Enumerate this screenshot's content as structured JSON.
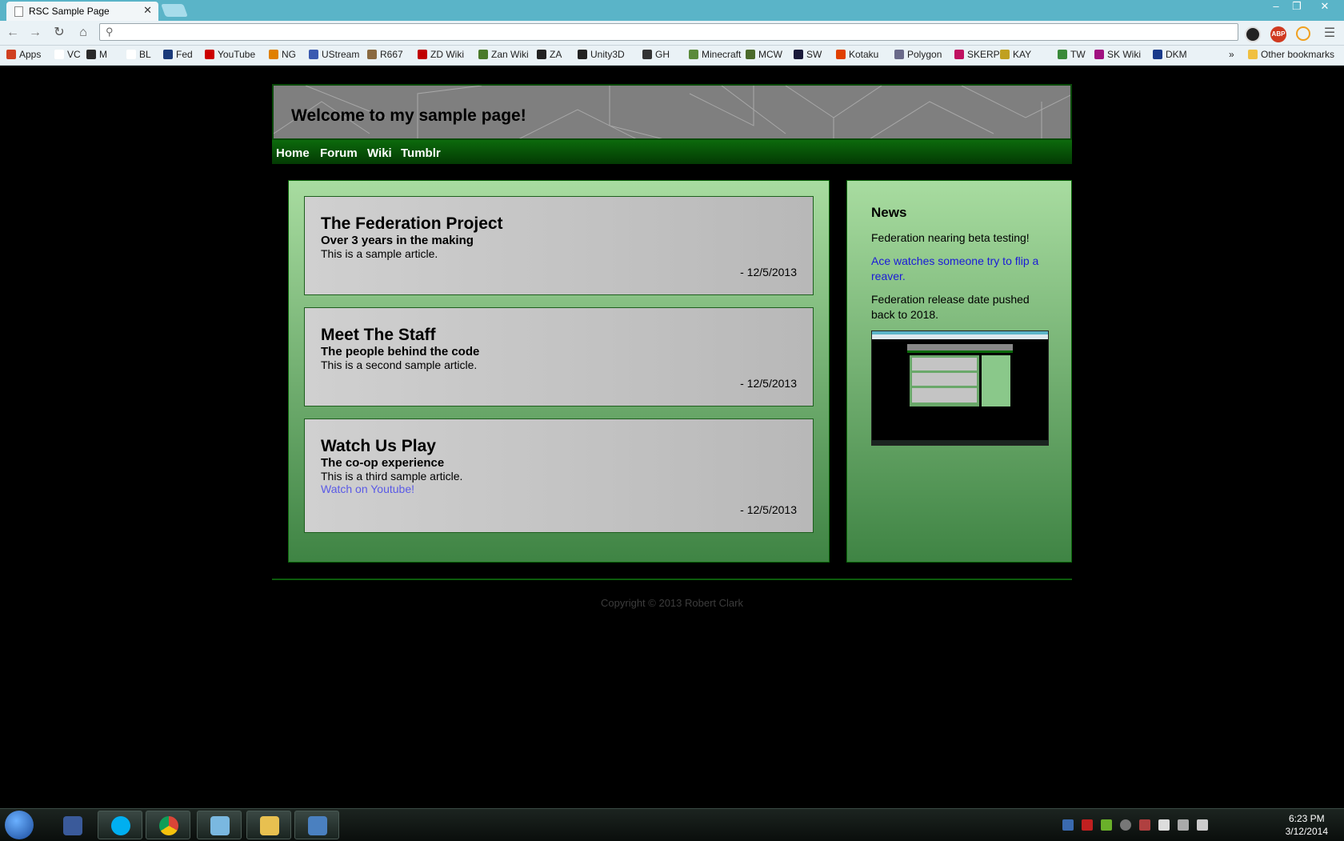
{
  "browser": {
    "tab_title": "RSC Sample Page",
    "tab_close": "✕",
    "url": "",
    "bookmarks": [
      {
        "label": "Apps",
        "color": "#d04020"
      },
      {
        "label": "VC",
        "color": "#ffffff"
      },
      {
        "label": "M",
        "color": "#2a2a2a"
      },
      {
        "label": "BL",
        "color": "#ffffff"
      },
      {
        "label": "Fed",
        "color": "#1a3a7a"
      },
      {
        "label": "YouTube",
        "color": "#cc0000"
      },
      {
        "label": "NG",
        "color": "#e08000"
      },
      {
        "label": "UStream",
        "color": "#3a5ab0"
      },
      {
        "label": "R667",
        "color": "#8a6a40"
      },
      {
        "label": "ZD Wiki",
        "color": "#c00000"
      },
      {
        "label": "Zan Wiki",
        "color": "#4a7a2a"
      },
      {
        "label": "ZA",
        "color": "#222222"
      },
      {
        "label": "Unity3D",
        "color": "#222222"
      },
      {
        "label": "GH",
        "color": "#333333"
      },
      {
        "label": "Minecraft",
        "color": "#5a8a3a"
      },
      {
        "label": "MCW",
        "color": "#4a6a2a"
      },
      {
        "label": "SW",
        "color": "#1a1a3a"
      },
      {
        "label": "Kotaku",
        "color": "#e04000"
      },
      {
        "label": "Polygon",
        "color": "#6a6a8a"
      },
      {
        "label": "SKERP",
        "color": "#c01060"
      },
      {
        "label": "KAY",
        "color": "#c0a020"
      },
      {
        "label": "TW",
        "color": "#3a8a3a"
      },
      {
        "label": "SK Wiki",
        "color": "#a01080"
      },
      {
        "label": "DKM",
        "color": "#1a3a8a"
      }
    ],
    "more_bookmarks": "»",
    "other_bookmarks": "Other bookmarks",
    "extensions": [
      {
        "label": "",
        "color": "#2a2a2a"
      },
      {
        "label": "ABP",
        "color": "#d03a20"
      },
      {
        "label": "",
        "color": "#f0a020"
      }
    ]
  },
  "site": {
    "title": "Welcome to my sample page!",
    "nav": [
      "Home",
      "Forum",
      "Wiki",
      "Tumblr"
    ],
    "articles": [
      {
        "title": "The Federation Project",
        "subtitle": "Over 3 years in the making",
        "body": "This is a sample article.",
        "link": "",
        "date": "- 12/5/2013"
      },
      {
        "title": "Meet The Staff",
        "subtitle": "The people behind the code",
        "body": "This is a second sample article.",
        "link": "",
        "date": "- 12/5/2013"
      },
      {
        "title": "Watch Us Play",
        "subtitle": "The co-op experience",
        "body": "This is a third sample article.",
        "link": "Watch on Youtube!",
        "date": "- 12/5/2013"
      }
    ],
    "news": {
      "heading": "News",
      "items": [
        {
          "text": "Federation nearing beta testing!",
          "is_link": false
        },
        {
          "text": "Ace watches someone try to flip a reaver.",
          "is_link": true
        },
        {
          "text": "Federation release date pushed back to 2018.",
          "is_link": false
        }
      ]
    },
    "copyright": "Copyright © 2013 Robert Clark"
  },
  "taskbar": {
    "apps": [
      {
        "name": "sapien",
        "color": "#3a5a9a"
      },
      {
        "name": "skype",
        "color": "#00aff0"
      },
      {
        "name": "chrome",
        "color": "#e0a020"
      },
      {
        "name": "notepad",
        "color": "#7ab8e0"
      },
      {
        "name": "explorer",
        "color": "#e8c050"
      },
      {
        "name": "wordpad",
        "color": "#4a80c0"
      }
    ],
    "time": "6:23 PM",
    "date": "3/12/2014"
  },
  "colors": {
    "panel_green_top": "#a8dca0",
    "panel_green_bottom": "#3f8444",
    "nav_green": "#0c6a0c",
    "link_blue": "#1a1ad8"
  }
}
